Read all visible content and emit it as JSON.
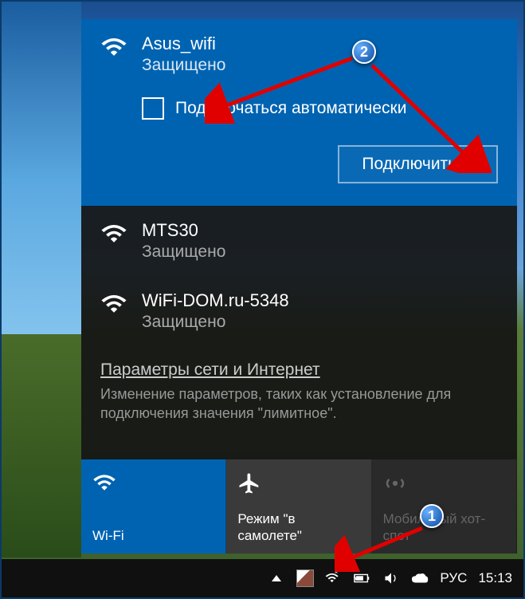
{
  "networks": [
    {
      "name": "Asus_wifi",
      "status": "Защищено",
      "selected": true
    },
    {
      "name": "MTS30",
      "status": "Защищено",
      "selected": false
    },
    {
      "name": "WiFi-DOM.ru-5348",
      "status": "Защищено",
      "selected": false
    }
  ],
  "autoConnect": {
    "label": "Подключаться автоматически",
    "checked": false
  },
  "connectButton": "Подключиться",
  "settings": {
    "link": "Параметры сети и Интернет",
    "description": "Изменение параметров, таких как установление для подключения значения \"лимитное\"."
  },
  "tiles": {
    "wifi": "Wi-Fi",
    "airplane": "Режим \"в самолете\"",
    "hotspot": "Мобильный хот-спот"
  },
  "taskbar": {
    "lang": "РУС",
    "time": "15:13"
  },
  "annotations": {
    "step1": "1",
    "step2": "2"
  }
}
